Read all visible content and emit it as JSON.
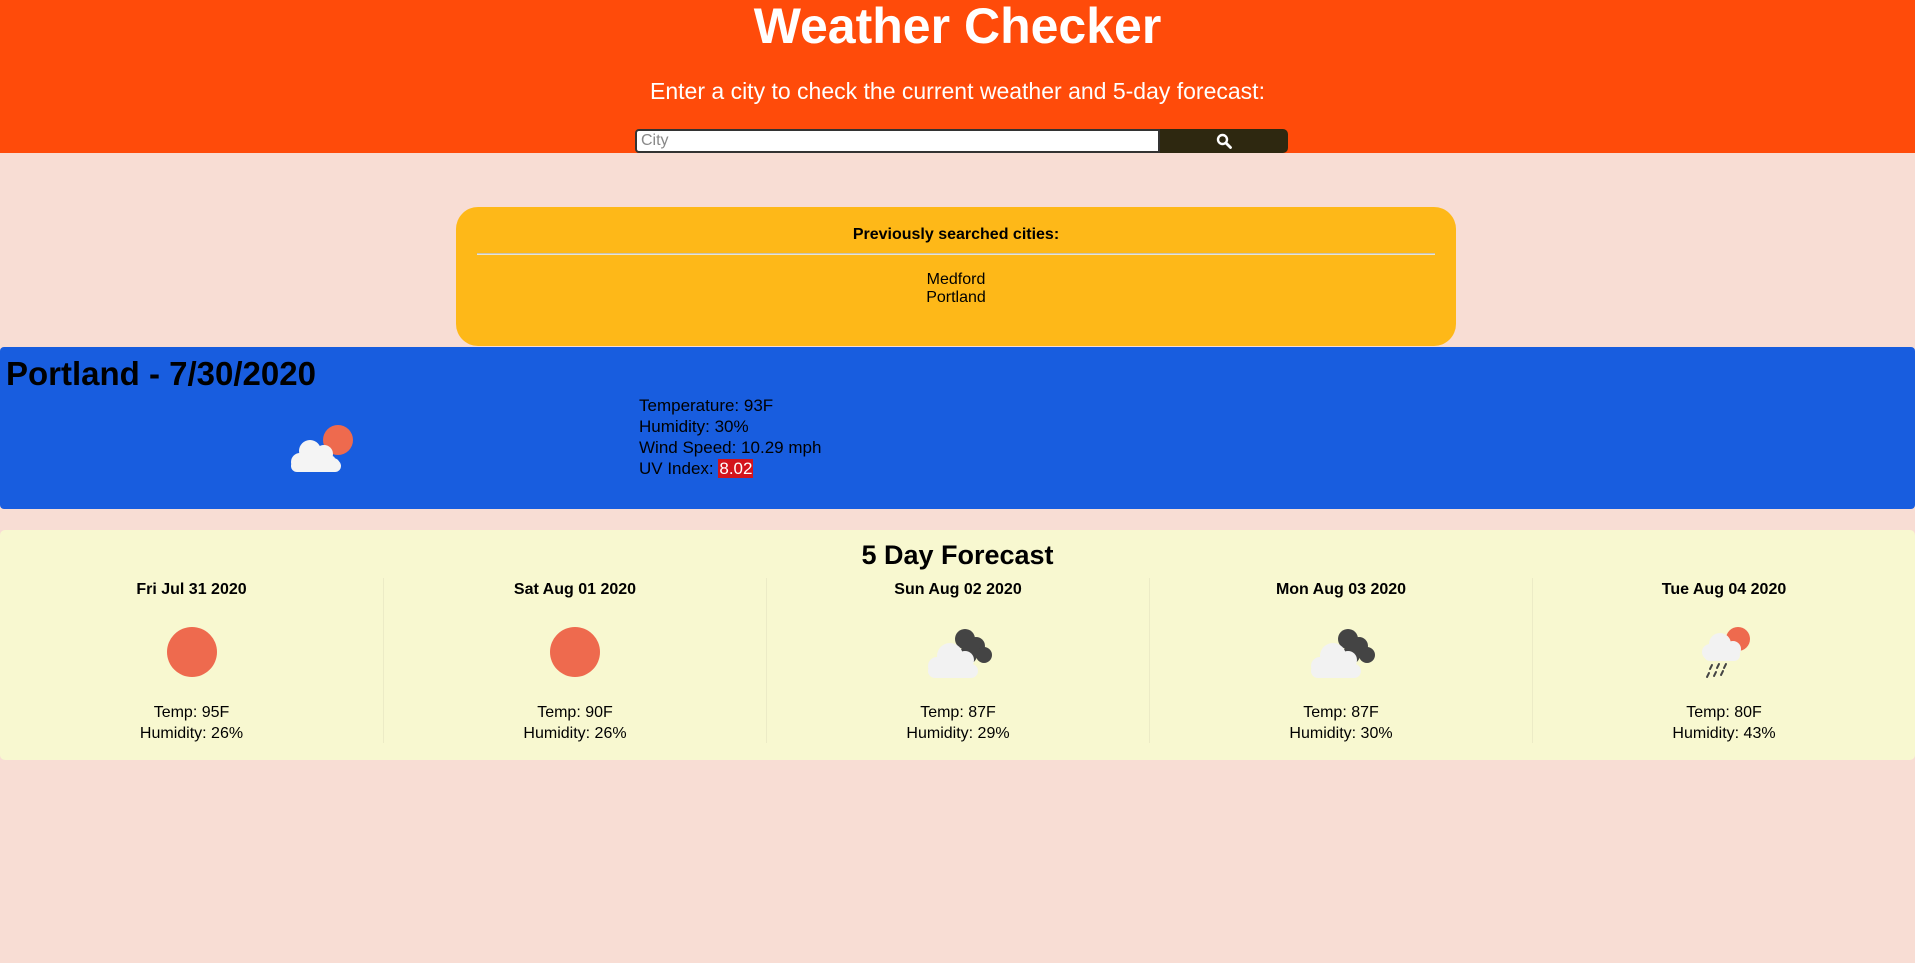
{
  "header": {
    "title": "Weather Checker",
    "subtitle": "Enter a city to check the current weather and 5-day forecast:",
    "search_placeholder": "City",
    "search_icon": "search-icon"
  },
  "history": {
    "title": "Previously searched cities:",
    "cities": [
      "Medford",
      "Portland"
    ]
  },
  "current": {
    "title": "Portland - 7/30/2020",
    "icon": "partly-cloudy-day-icon",
    "temperature": "Temperature: 93F",
    "humidity": "Humidity: 30%",
    "wind": "Wind Speed: 10.29 mph",
    "uv_label": "UV Index: ",
    "uv_value": "8.02",
    "uv_color": "#d3141d"
  },
  "forecast": {
    "title": "5 Day Forecast",
    "days": [
      {
        "date": "Fri Jul 31 2020",
        "icon": "sun-icon",
        "temp": "Temp: 95F",
        "humidity": "Humidity: 26%"
      },
      {
        "date": "Sat Aug 01 2020",
        "icon": "sun-icon",
        "temp": "Temp: 90F",
        "humidity": "Humidity: 26%"
      },
      {
        "date": "Sun Aug 02 2020",
        "icon": "broken-clouds-icon",
        "temp": "Temp: 87F",
        "humidity": "Humidity: 29%"
      },
      {
        "date": "Mon Aug 03 2020",
        "icon": "broken-clouds-icon",
        "temp": "Temp: 87F",
        "humidity": "Humidity: 30%"
      },
      {
        "date": "Tue Aug 04 2020",
        "icon": "rain-sun-icon",
        "temp": "Temp: 80F",
        "humidity": "Humidity: 43%"
      }
    ]
  },
  "colors": {
    "header_bg": "#ff4b0a",
    "page_bg": "#f8ddd4",
    "history_bg": "#feb818",
    "current_bg": "#185ddf",
    "forecast_bg": "#f8f8d0",
    "sun": "#ee6a4e"
  }
}
